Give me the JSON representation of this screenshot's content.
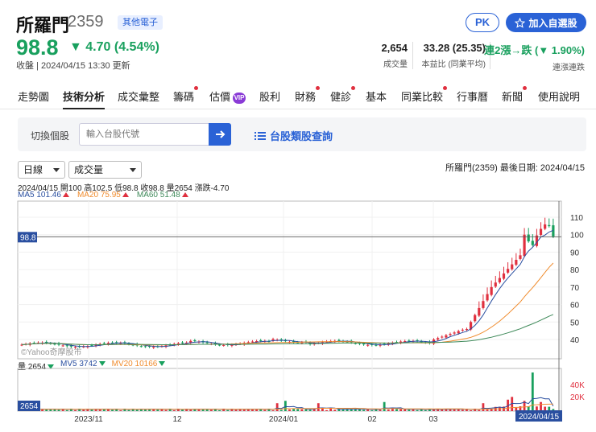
{
  "header": {
    "name": "所羅門",
    "code": "2359",
    "tag": "其他電子",
    "price": "98.8",
    "change": "▼ 4.70 (4.54%)",
    "close_time": "收盤 | 2024/04/15 13:30 更新",
    "pk_label": "PK",
    "add_label": "加入自選股",
    "stats": [
      {
        "value": "2,654",
        "label": "成交量"
      },
      {
        "value": "33.28 (25.35)",
        "label": "本益比 (同業平均)"
      },
      {
        "value": "連2漲→跌 (▼ 1.90%)",
        "label": "連漲連跌"
      }
    ]
  },
  "tabs": [
    {
      "label": "走勢圖",
      "dot": false
    },
    {
      "label": "技術分析",
      "dot": false,
      "active": true
    },
    {
      "label": "成交彙整",
      "dot": false
    },
    {
      "label": "籌碼",
      "dot": true
    },
    {
      "label": "估價",
      "dot": false,
      "vip": "VIP"
    },
    {
      "label": "股利",
      "dot": false
    },
    {
      "label": "財務",
      "dot": true
    },
    {
      "label": "健診",
      "dot": true
    },
    {
      "label": "基本",
      "dot": false
    },
    {
      "label": "同業比較",
      "dot": true
    },
    {
      "label": "行事曆",
      "dot": false
    },
    {
      "label": "新聞",
      "dot": true
    },
    {
      "label": "使用說明",
      "dot": false
    }
  ],
  "search": {
    "label": "切換個股",
    "placeholder": "輸入台股代號",
    "category_link": "台股類股查詢"
  },
  "controls": {
    "period": "日線",
    "indicator": "成交量",
    "last_date": "所羅門(2359)  最後日期: 2024/04/15"
  },
  "legend": {
    "ohlc": "2024/04/15 開100 高102.5 低98.8 收98.8 量2654 漲跌-4.70",
    "ma5": "MA5 101.46",
    "ma20": "MA20 75.95",
    "ma60": "MA60 51.48",
    "vol": "量 2654",
    "mv5": "MV5 3742",
    "mv20": "MV20 10166"
  },
  "chart_data": {
    "type": "candlestick",
    "price_axis_ticks": [
      "110",
      "100",
      "90",
      "80",
      "70",
      "60",
      "50",
      "40"
    ],
    "volume_axis_ticks": [
      "40K",
      "20K"
    ],
    "x_tick_labels": [
      "2023/11",
      "12",
      "2024/01",
      "02",
      "03"
    ],
    "current_price_label": "98.8",
    "current_volume_label": "2654",
    "current_date_label": "2024/04/15",
    "watermark": "©Yahoo奇摩股市",
    "colors": {
      "up": "#e0303f",
      "down": "#19a05e",
      "ma5": "#2a4fa0",
      "ma20": "#f08c2e",
      "ma60": "#3f8a5a"
    }
  }
}
